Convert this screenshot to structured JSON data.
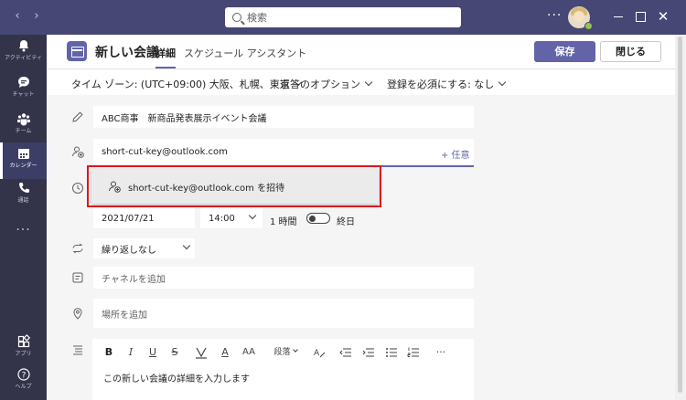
{
  "titlebar": {
    "search_placeholder": "検索",
    "more_label": "···",
    "close_label": "✕"
  },
  "rail": {
    "items": [
      {
        "label": "アクティビティ",
        "icon": "bell-icon"
      },
      {
        "label": "チャット",
        "icon": "chat-icon"
      },
      {
        "label": "チーム",
        "icon": "teams-icon"
      },
      {
        "label": "カレンダー",
        "icon": "calendar-icon",
        "active": true
      },
      {
        "label": "通話",
        "icon": "phone-icon"
      }
    ],
    "more_label": "···",
    "apps_label": "アプリ",
    "help_label": "ヘルプ"
  },
  "header": {
    "title": "新しい会議",
    "tabs": [
      "詳細",
      "スケジュール アシスタント"
    ],
    "save_label": "保存",
    "close_label": "閉じる"
  },
  "options": {
    "timezone": "タイム ゾーン: (UTC+09:00) 大阪、札幌、東京",
    "reply_options": "返答のオプション",
    "registration": "登録を必須にする: なし"
  },
  "form": {
    "title_value": "ABC商事　新商品発表展示イベント会議",
    "attendee_value": "short-cut-key@outlook.com",
    "optional_label": "+ 任意",
    "suggestion_text": "short-cut-key@outlook.com を招待",
    "date_value": "2021/07/21",
    "time_value": "14:00",
    "duration_label": "1 時間",
    "allday_label": "終日",
    "repeat_value": "繰り返しなし",
    "channel_placeholder": "チャネルを追加",
    "location_placeholder": "場所を追加",
    "details_placeholder": "この新しい会議の詳細を入力します"
  },
  "editor_toolbar": {
    "bold": "B",
    "italic": "I",
    "underline": "U",
    "strike": "S",
    "font_color": "A",
    "font_size": "AA",
    "paragraph_label": "段落",
    "more": "···"
  },
  "colors": {
    "titlebar": "#464775",
    "rail": "#33344a",
    "accent": "#6264a7",
    "highlight_border": "#e0141e",
    "status_available": "#92c353"
  }
}
